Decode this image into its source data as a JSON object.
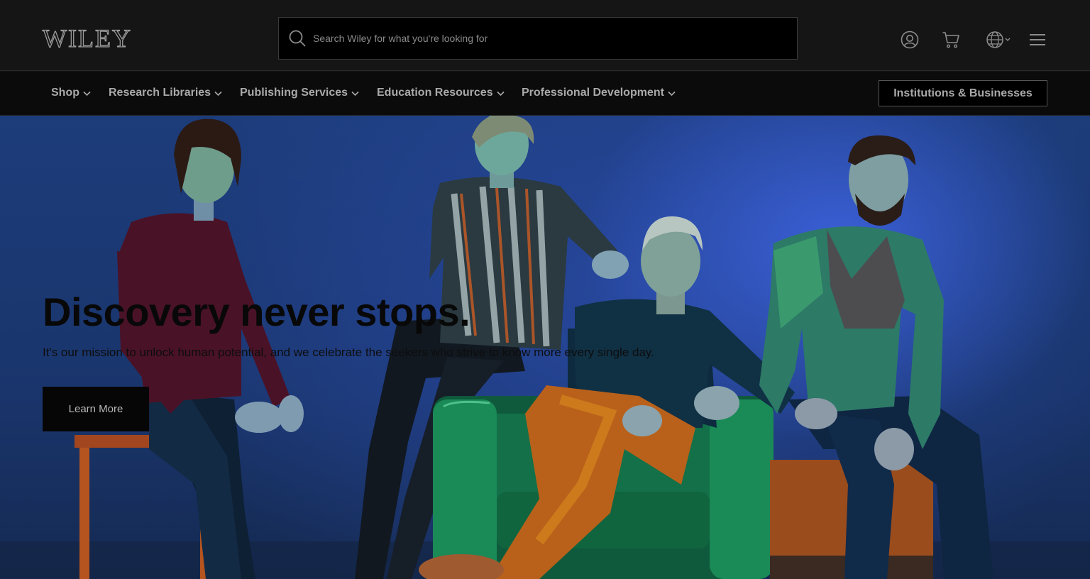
{
  "header": {
    "logo_text": "WILEY",
    "search_placeholder": "Search Wiley for what you're looking for",
    "icons": [
      "account-icon",
      "cart-icon",
      "globe-icon",
      "menu-icon"
    ]
  },
  "nav": {
    "items": [
      {
        "label": "Shop"
      },
      {
        "label": "Research Libraries"
      },
      {
        "label": "Publishing Services"
      },
      {
        "label": "Education Resources"
      },
      {
        "label": "Professional Development"
      }
    ],
    "cta_label": "Institutions & Businesses"
  },
  "hero": {
    "title": "Discovery never stops.",
    "subtitle": "It's our mission to unlock human potential, and we celebrate the seekers who strive to know more every single day.",
    "button_label": "Learn More"
  },
  "colors": {
    "header_bg": "#151515",
    "nav_bg": "#0b0b0b",
    "hero_bg": "#1c3c7a",
    "button_bg": "#060606"
  }
}
